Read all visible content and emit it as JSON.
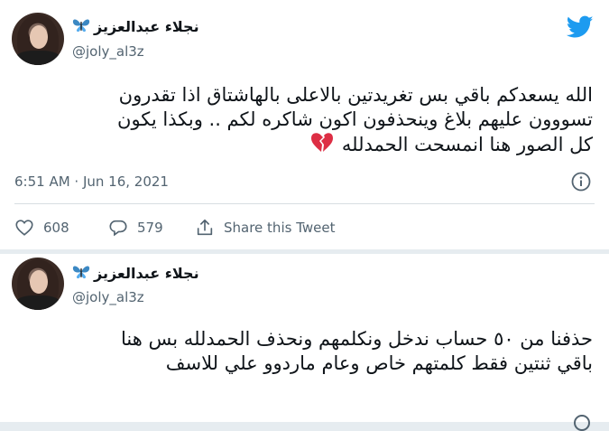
{
  "tweets": [
    {
      "display_name": "نجلاء عبدالعزيز",
      "handle": "@joly_al3z",
      "text_lines": [
        "الله يسعدكم باقي بس تغريدتين بالاعلى بالهاشتاق اذا تقدرون",
        "تسووون عليهم بلاغ وينحذفون اكون شاكره لكم .. وبكذا يكون",
        "كل الصور هنا انمسحت الحمدلله"
      ],
      "timestamp": "6:51 AM · Jun 16, 2021",
      "likes": "608",
      "replies": "579",
      "share_label": "Share this Tweet"
    },
    {
      "display_name": "نجلاء عبدالعزيز",
      "handle": "@joly_al3z",
      "text_lines": [
        "حذفنا من ٥٠ حساب ندخل ونكلمهم ونحذف الحمدلله بس هنا",
        "باقي ثنتين فقط كلمتهم خاص وعام ماردوو علي للاسف"
      ]
    }
  ],
  "icons": {
    "name_emoji": "butterfly-icon",
    "text_emoji": "broken-heart-icon",
    "brand": "twitter-bird-icon"
  },
  "colors": {
    "twitter_blue": "#1d9bf0",
    "secondary_text": "#536471",
    "broken_heart": "#dd2e44",
    "butterfly": "#3b88c3"
  }
}
